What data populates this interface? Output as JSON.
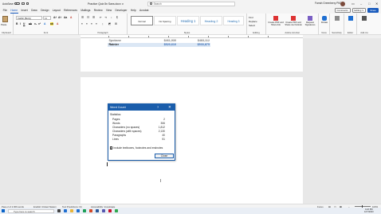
{
  "titlebar": {
    "autosave": "AutoSave",
    "autosave_state": "Off",
    "doc_title": "Practice Quiz 8n Sans.docx ∨",
    "search_placeholder": "Search",
    "user_name": "Farrah Greenberry PhD"
  },
  "tabs": [
    "File",
    "Home",
    "Insert",
    "Draw",
    "Design",
    "Layout",
    "References",
    "Mailings",
    "Review",
    "View",
    "Developer",
    "Help",
    "Acrobat"
  ],
  "active_tab": "Home",
  "tab_actions": {
    "comments": "Comments",
    "editing": "Editing ∨",
    "share": "Share"
  },
  "ribbon": {
    "clipboard": {
      "paste": "Paste",
      "label": "Clipboard"
    },
    "font": {
      "name": "Calibri (Body)",
      "size": "11",
      "label": "Font"
    },
    "paragraph": {
      "label": "Paragraph"
    },
    "styles": {
      "items": [
        "Normal",
        "No Spacing",
        "Heading 1",
        "Heading 2",
        "Heading 3"
      ],
      "label": "Styles"
    },
    "editing": {
      "find": "Find",
      "replace": "Replace",
      "select": "Select",
      "label": "Editing"
    },
    "adobe": {
      "create_pdf": "Create PDF and Share link",
      "create_pdf_outlook": "Create PDF and Share via Outlook",
      "request_sign": "Request Signatures",
      "label": "Adobe Acrobat"
    },
    "voice": {
      "dictate": "Dictate",
      "label": "Voice"
    },
    "sensitivity": {
      "label": "Sensitivity"
    },
    "editor": {
      "label": "Editor"
    },
    "addins": {
      "label": "Add-ins"
    }
  },
  "table": [
    {
      "name": "Spokane",
      "v1": "$461,930",
      "v2": "$483,112",
      "cut": true
    },
    {
      "name": "Rainier",
      "v1": "$520,610",
      "v2": "$533,875",
      "cut": false
    }
  ],
  "dialog": {
    "title": "Word Count",
    "help": "?",
    "close_x": "✕",
    "section": "Statistics:",
    "stats": [
      {
        "label": "Pages",
        "value": "2"
      },
      {
        "label": "Words",
        "value": "306"
      },
      {
        "label": "Characters (no spaces)",
        "value": "1,812"
      },
      {
        "label": "Characters (with spaces)",
        "value": "2,130"
      },
      {
        "label": "Paragraphs",
        "value": "40"
      },
      {
        "label": "Lines",
        "value": "51"
      }
    ],
    "checkbox_label": "Include textboxes, footnotes and endnotes",
    "checkbox_checked": true,
    "close_button": "Close"
  },
  "statusbar": {
    "page": "Page 2 of 2",
    "words": "306 words",
    "language": "English (United States)",
    "text_predictions": "Text Predictions: On",
    "accessibility": "Accessibility: Investigate",
    "focus": "Focus",
    "zoom": "100%"
  },
  "taskbar": {
    "search": "Type here to search",
    "time": "4:22 PM",
    "date": "1/17/2023"
  }
}
